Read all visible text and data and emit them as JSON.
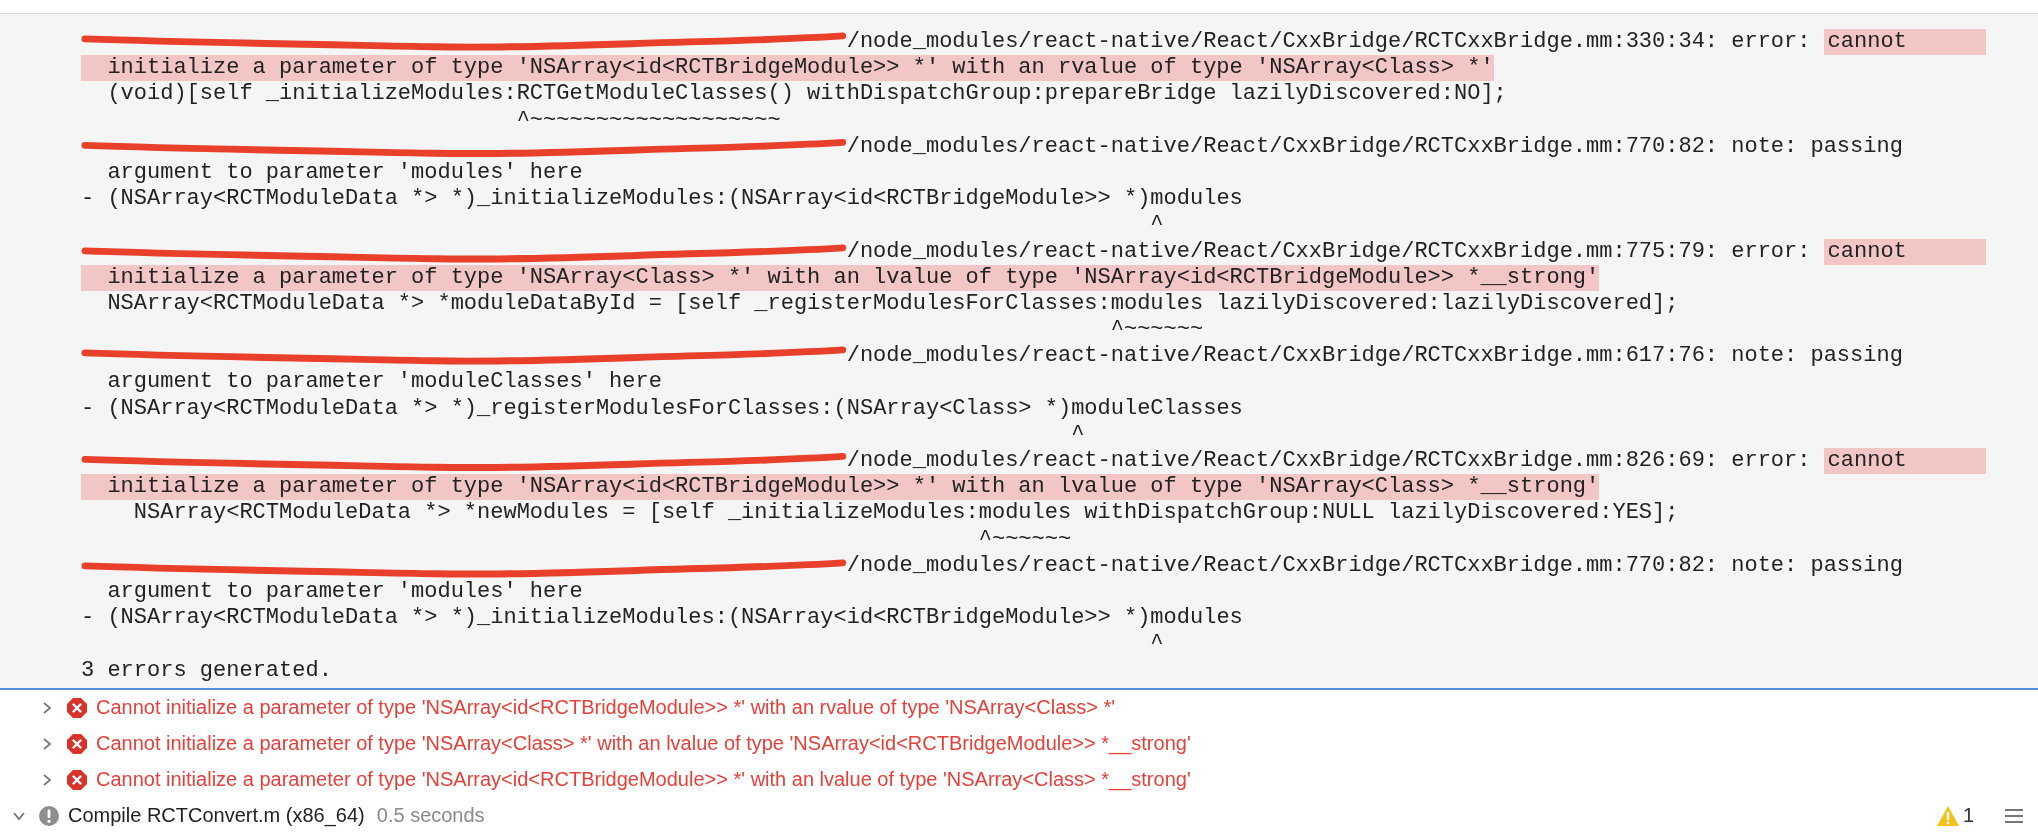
{
  "build_log": {
    "entries": [
      {
        "kind": "error",
        "redacted": true,
        "location": "/node_modules/react-native/React/CxxBridge/RCTCxxBridge.mm:330:34:",
        "label": "error:",
        "message": [
          "cannot",
          "initialize a parameter of type 'NSArray<id<RCTBridgeModule>> *' with an rvalue of type 'NSArray<Class> *'"
        ],
        "code": "  (void)[self _initializeModules:RCTGetModuleClasses() withDispatchGroup:prepareBridge lazilyDiscovered:NO];",
        "caret": "                                 ^~~~~~~~~~~~~~~~~~~~"
      },
      {
        "kind": "note",
        "redacted": true,
        "location": "/node_modules/react-native/React/CxxBridge/RCTCxxBridge.mm:770:82:",
        "label": "note:",
        "message": [
          "passing",
          "argument to parameter 'modules' here"
        ],
        "code": "- (NSArray<RCTModuleData *> *)_initializeModules:(NSArray<id<RCTBridgeModule>> *)modules",
        "caret": "                                                                                 ^"
      },
      {
        "kind": "error",
        "redacted": true,
        "location": "/node_modules/react-native/React/CxxBridge/RCTCxxBridge.mm:775:79:",
        "label": "error:",
        "message": [
          "cannot",
          "initialize a parameter of type 'NSArray<Class> *' with an lvalue of type 'NSArray<id<RCTBridgeModule>> *__strong'"
        ],
        "code": "  NSArray<RCTModuleData *> *moduleDataById = [self _registerModulesForClasses:modules lazilyDiscovered:lazilyDiscovered];",
        "caret": "                                                                              ^~~~~~~"
      },
      {
        "kind": "note",
        "redacted": true,
        "location": "/node_modules/react-native/React/CxxBridge/RCTCxxBridge.mm:617:76:",
        "label": "note:",
        "message": [
          "passing",
          "argument to parameter 'moduleClasses' here"
        ],
        "code": "- (NSArray<RCTModuleData *> *)_registerModulesForClasses:(NSArray<Class> *)moduleClasses",
        "caret": "                                                                           ^"
      },
      {
        "kind": "error",
        "redacted": true,
        "location": "/node_modules/react-native/React/CxxBridge/RCTCxxBridge.mm:826:69:",
        "label": "error:",
        "message": [
          "cannot",
          "initialize a parameter of type 'NSArray<id<RCTBridgeModule>> *' with an lvalue of type 'NSArray<Class> *__strong'"
        ],
        "code": "    NSArray<RCTModuleData *> *newModules = [self _initializeModules:modules withDispatchGroup:NULL lazilyDiscovered:YES];",
        "caret": "                                                                    ^~~~~~~"
      },
      {
        "kind": "note",
        "redacted": true,
        "location": "/node_modules/react-native/React/CxxBridge/RCTCxxBridge.mm:770:82:",
        "label": "note:",
        "message": [
          "passing",
          "argument to parameter 'modules' here"
        ],
        "code": "- (NSArray<RCTModuleData *> *)_initializeModules:(NSArray<id<RCTBridgeModule>> *)modules",
        "caret": "                                                                                 ^"
      }
    ],
    "summary": "3 errors generated."
  },
  "issues": [
    {
      "kind": "error",
      "expanded": false,
      "text": "Cannot initialize a parameter of type 'NSArray<id<RCTBridgeModule>> *' with an rvalue of type 'NSArray<Class> *'"
    },
    {
      "kind": "error",
      "expanded": false,
      "text": "Cannot initialize a parameter of type 'NSArray<Class> *' with an lvalue of type 'NSArray<id<RCTBridgeModule>> *__strong'"
    },
    {
      "kind": "error",
      "expanded": false,
      "text": "Cannot initialize a parameter of type 'NSArray<id<RCTBridgeModule>> *' with an lvalue of type 'NSArray<Class> *__strong'"
    },
    {
      "kind": "compile",
      "expanded": true,
      "text": "Compile RCTConvert.m (x86_64)",
      "duration": "0.5 seconds"
    }
  ],
  "status": {
    "warning_count": "1"
  }
}
